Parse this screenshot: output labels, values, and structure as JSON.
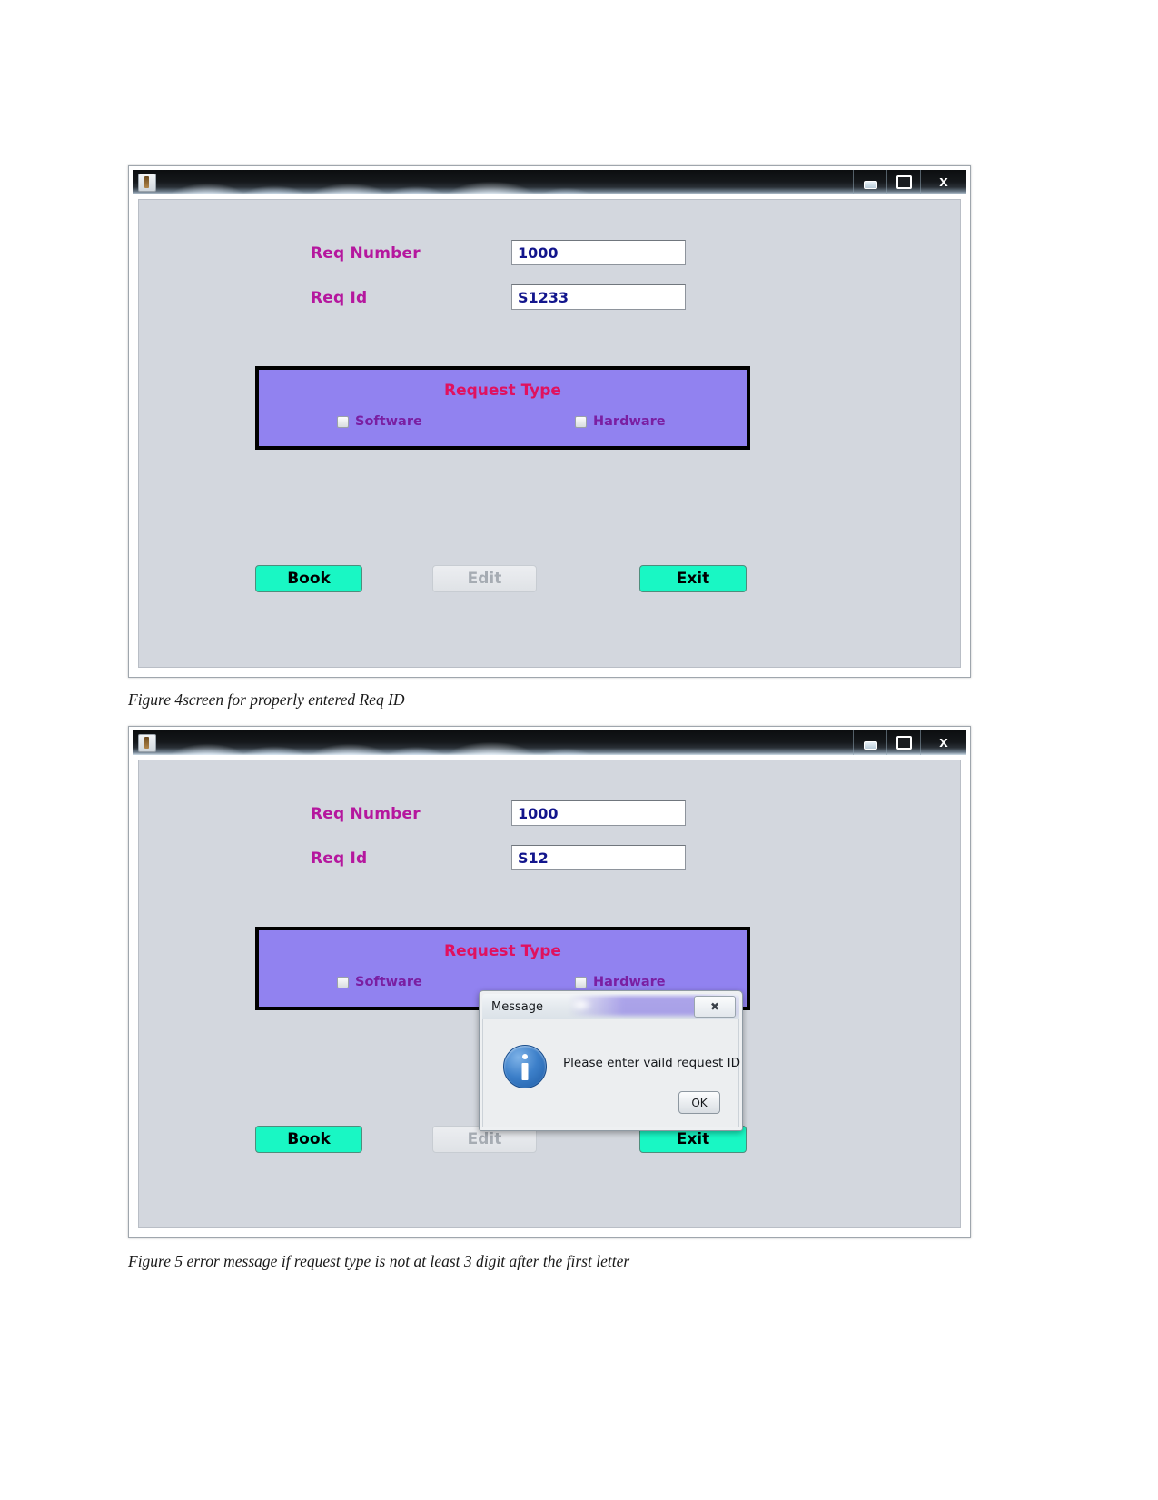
{
  "document": {
    "figures": [
      {
        "id": "figure-4",
        "caption": "Figure 4screen for properly entered Req ID",
        "window": {
          "title": "",
          "app_icon": "java-coffee-cup-icon",
          "controls": {
            "minimize": "minimize-icon",
            "maximize": "maximize-icon",
            "close": "x"
          },
          "fields": [
            {
              "label": "Req Number",
              "value": "1000"
            },
            {
              "label": "Req Id",
              "value": "S1233"
            }
          ],
          "request_type": {
            "title": "Request Type",
            "options": [
              {
                "label": "Software",
                "checked": false
              },
              {
                "label": "Hardware",
                "checked": false
              }
            ]
          },
          "buttons": [
            {
              "label": "Book",
              "state": "enabled"
            },
            {
              "label": "Edit",
              "state": "disabled"
            },
            {
              "label": "Exit",
              "state": "enabled"
            }
          ]
        }
      },
      {
        "id": "figure-5",
        "caption": "Figure 5 error message if request type is not at least 3 digit after the first letter",
        "window": {
          "title": "",
          "app_icon": "java-coffee-cup-icon",
          "controls": {
            "minimize": "minimize-icon",
            "maximize": "maximize-icon",
            "close": "x"
          },
          "fields": [
            {
              "label": "Req Number",
              "value": "1000"
            },
            {
              "label": "Req Id",
              "value": "S12"
            }
          ],
          "request_type": {
            "title": "Request Type",
            "options": [
              {
                "label": "Software",
                "checked": false
              },
              {
                "label": "Hardware",
                "checked": false
              }
            ]
          },
          "buttons": [
            {
              "label": "Book",
              "state": "enabled"
            },
            {
              "label": "Edit",
              "state": "disabled"
            },
            {
              "label": "Exit",
              "state": "enabled"
            }
          ],
          "dialog": {
            "title": "Message",
            "icon": "information-icon",
            "message": "Please enter vaild request ID",
            "ok_label": "OK",
            "close_label": "✖"
          }
        }
      }
    ]
  },
  "colors": {
    "panel_bg": "#d3d7de",
    "label_pink": "#b5179e",
    "value_blue": "#12158c",
    "group_purple": "#9182f0",
    "group_title_red": "#e0115f",
    "checkbox_label_purple": "#7a1fa2",
    "button_green": "#19f7c4",
    "button_disabled_text": "#a6acb3"
  }
}
